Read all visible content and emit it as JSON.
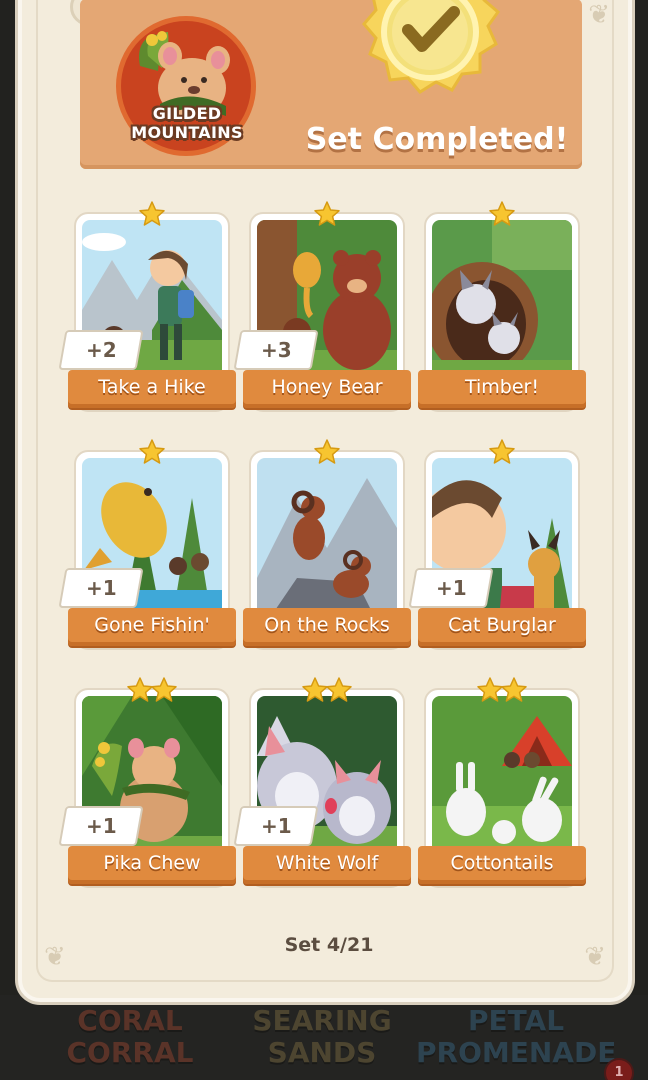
{
  "background": {
    "sets": [
      "CORAL CORRAL",
      "SEARING SANDS",
      "PETAL PROMENADE"
    ],
    "notification_count": "1"
  },
  "header": {
    "set_name": "GILDED MOUNTAINS",
    "status": "Set Completed!"
  },
  "cards": [
    {
      "name": "Take a Hike",
      "stars": 1,
      "extra": "+2",
      "scene": "hike"
    },
    {
      "name": "Honey Bear",
      "stars": 1,
      "extra": "+3",
      "scene": "bear"
    },
    {
      "name": "Timber!",
      "stars": 1,
      "extra": null,
      "scene": "husky"
    },
    {
      "name": "Gone Fishin'",
      "stars": 1,
      "extra": "+1",
      "scene": "fish"
    },
    {
      "name": "On the Rocks",
      "stars": 1,
      "extra": null,
      "scene": "rams"
    },
    {
      "name": "Cat Burglar",
      "stars": 1,
      "extra": "+1",
      "scene": "lynx"
    },
    {
      "name": "Pika Chew",
      "stars": 2,
      "extra": "+1",
      "scene": "pika"
    },
    {
      "name": "White Wolf",
      "stars": 2,
      "extra": "+1",
      "scene": "wolf"
    },
    {
      "name": "Cottontails",
      "stars": 2,
      "extra": null,
      "scene": "rabbits"
    }
  ],
  "footer": {
    "set_counter": "Set 4/21"
  },
  "colors": {
    "banner": "#e4a774",
    "ribbon": "#e08a3e",
    "panel": "#f3ecdc",
    "star": "#f7c530"
  }
}
